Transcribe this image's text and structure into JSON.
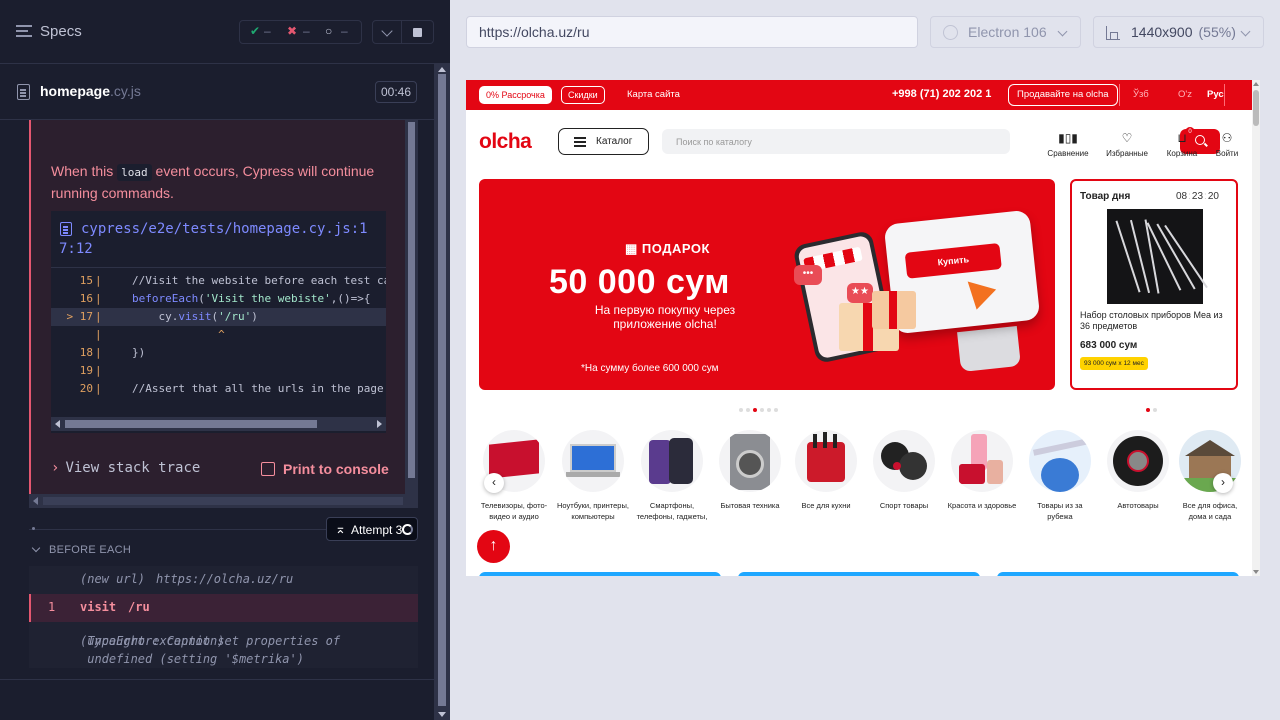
{
  "runner": {
    "specs_label": "Specs",
    "stats": {
      "passed": "✔",
      "passed_count": "–",
      "failed": "✖",
      "failed_count": "–",
      "pending": "○",
      "pending_count": "–"
    },
    "spec_file": {
      "name": "homepage",
      "ext": ".cy.js",
      "duration": "00:46"
    },
    "error": {
      "message_before": "When this ",
      "message_code": "load",
      "message_after": " event occurs, Cypress will continue running commands.",
      "file_path": "cypress/e2e/tests/homepage.cy.js:17:12",
      "code_lines": [
        {
          "num": "15",
          "marker": "",
          "code": "    //Visit the website before each test ca"
        },
        {
          "num": "16",
          "marker": "",
          "code": "    beforeEach('Visit the webiste',()=>{"
        },
        {
          "num": "17",
          "marker": ">",
          "code": "        cy.visit('/ru')"
        },
        {
          "num": "",
          "marker": "",
          "code": "              ^"
        },
        {
          "num": "18",
          "marker": "",
          "code": "    })"
        },
        {
          "num": "19",
          "marker": "",
          "code": ""
        },
        {
          "num": "20",
          "marker": "",
          "code": "    //Assert that all the urls in the page"
        }
      ],
      "stack_trace_label": "View stack trace",
      "print_label": "Print to console"
    },
    "attempt_label": "Attempt 3",
    "hook_label": "BEFORE EACH",
    "commands": [
      {
        "num": "",
        "name": "(new url)",
        "message": "https://olcha.uz/ru"
      },
      {
        "num": "1",
        "name": "visit",
        "message": "/ru"
      },
      {
        "num": "",
        "name": "(uncaught exception)",
        "message": "TypeError: Cannot set properties of undefined (setting '$metrika')"
      }
    ]
  },
  "browser": {
    "url": "https://olcha.uz/ru",
    "browser_name": "Electron 106",
    "viewport": "1440x900",
    "scale": "(55%)"
  },
  "site": {
    "topbar": {
      "installment": "0% Рассрочка",
      "discounts": "Скидки",
      "sitemap": "Карта сайта",
      "phone": "+998 (71) 202 202 1",
      "sell": "Продавайте на olcha",
      "langs": [
        "Ўзб",
        "O'z",
        "Рус"
      ]
    },
    "logo": "olcha",
    "catalog": "Каталог",
    "search_placeholder": "Поиск по каталогу",
    "header_icons": [
      {
        "icon": "chart-icon",
        "glyph": "📊",
        "label": "Сравнение"
      },
      {
        "icon": "heart-icon",
        "glyph": "♡",
        "label": "Избранные"
      },
      {
        "icon": "cart-icon",
        "glyph": "🛒",
        "label": "Корзина",
        "badge": "0"
      },
      {
        "icon": "user-icon",
        "glyph": "👤",
        "label": "Войти"
      }
    ],
    "banner": {
      "gift": "ПОДАРОК",
      "amount": "50 000 сум",
      "subtitle": "На первую покупку через приложение olcha!",
      "note": "*На сумму более 600 000 сум",
      "buy_label": "Купить",
      "chat1": "•••",
      "chat2": "★★"
    },
    "deal": {
      "title": "Товар дня",
      "hours": "08",
      "minutes": "23",
      "seconds": "20",
      "name": "Набор столовых приборов Mea из 36 предметов",
      "price": "683 000 сум",
      "installment": "93 000 сум x 12 мес"
    },
    "categories": [
      "Телевизоры, фото-видео и аудио",
      "Ноутбуки, принтеры, компьютеры",
      "Смартфоны, телефоны, гаджеты,",
      "Бытовая техника",
      "Все для кухни",
      "Спорт товары",
      "Красота и здоровье",
      "Товары из за рубежа",
      "Автотовары",
      "Все для офиса, дома и сада"
    ],
    "arrow_left": "‹",
    "arrow_right": "›",
    "up": "↑"
  }
}
